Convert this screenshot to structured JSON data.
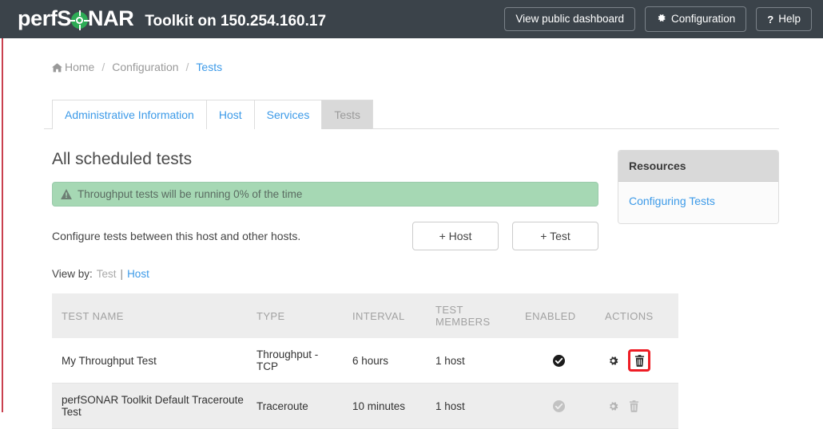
{
  "navbar": {
    "brand_prefix": "perfS",
    "brand_suffix": "NAR",
    "brand_icon": "target-crosshair-icon",
    "subtitle": "Toolkit on 150.254.160.17",
    "buttons": [
      {
        "label": "View public dashboard",
        "icon": null
      },
      {
        "label": "Configuration",
        "icon": "gear-icon"
      },
      {
        "label": "Help",
        "icon": "question-mark-icon"
      }
    ]
  },
  "breadcrumb": {
    "home_icon": "home-icon",
    "items": [
      {
        "label": "Home",
        "active": false
      },
      {
        "label": "Configuration",
        "active": false
      },
      {
        "label": "Tests",
        "active": true
      }
    ],
    "separator": "/"
  },
  "tabs": [
    {
      "label": "Administrative Information",
      "active": false
    },
    {
      "label": "Host",
      "active": false
    },
    {
      "label": "Services",
      "active": false
    },
    {
      "label": "Tests",
      "active": true
    }
  ],
  "main": {
    "title": "All scheduled tests",
    "alert": {
      "icon": "warning-triangle-icon",
      "text": "Throughput tests will be running 0% of the time",
      "background": "#a6d8b4"
    },
    "configure_text": "Configure tests between this host and other hosts.",
    "add_host_button": "+ Host",
    "add_test_button": "+ Test",
    "view_by": {
      "label": "View by:",
      "current": "Test",
      "separator": "|",
      "link": "Host"
    },
    "table": {
      "headers": {
        "name": "TEST NAME",
        "type": "TYPE",
        "interval": "INTERVAL",
        "members_line1": "TEST",
        "members_line2": "MEMBERS",
        "enabled": "ENABLED",
        "actions": "ACTIONS"
      },
      "rows": [
        {
          "name": "My Throughput Test",
          "type": "Throughput - TCP",
          "interval": "6 hours",
          "members": "1 host",
          "enabled_icon": "check-circle-icon",
          "enabled": true,
          "disabled_row": false,
          "actions": [
            "gear-icon",
            "trash-icon"
          ],
          "highlighted_action": "trash-icon"
        },
        {
          "name": "perfSONAR Toolkit Default Traceroute Test",
          "type": "Traceroute",
          "interval": "10 minutes",
          "members": "1 host",
          "enabled_icon": "check-circle-icon",
          "enabled": true,
          "disabled_row": true,
          "actions": [
            "gear-icon",
            "trash-icon"
          ],
          "highlighted_action": null
        }
      ]
    }
  },
  "sidebar": {
    "panel_title": "Resources",
    "links": [
      {
        "label": "Configuring Tests"
      }
    ]
  },
  "colors": {
    "navbar_bg": "#3b434a",
    "accent_link": "#3c9ae8",
    "logo_green": "#2dab55",
    "alert_green": "#a6d8b4",
    "highlight_red": "#ee1c25",
    "left_rail_red": "#c9404f",
    "tab_active_bg": "#d9d9d9"
  }
}
